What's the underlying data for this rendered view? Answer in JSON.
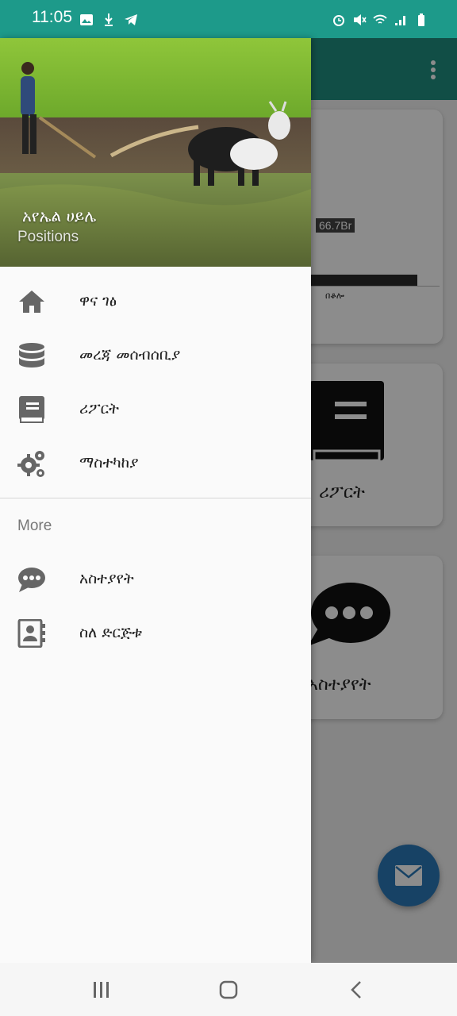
{
  "status_bar": {
    "time": "11:05",
    "left_icons": [
      "gallery-icon",
      "usb-icon",
      "telegram-icon"
    ],
    "right_icons": [
      "alarm-icon",
      "mute-icon",
      "wifi-icon",
      "signal-icon",
      "battery-icon"
    ]
  },
  "app": {
    "chart": {
      "value_label": "66.7Br",
      "category_label": "በቆሎ"
    },
    "cards": [
      {
        "label": "ሪፖርት",
        "icon": "book-icon"
      },
      {
        "label": "አስተያየት",
        "icon": "chat-icon"
      }
    ],
    "fab_icon": "mail-icon"
  },
  "drawer": {
    "user_name": "አየኤል ሀይሌ",
    "user_subtitle": "Positions",
    "menu_items": [
      {
        "label": "ዋና ገፅ",
        "icon": "home-icon"
      },
      {
        "label": "መረጃ መሰብሰቢያ",
        "icon": "database-icon"
      },
      {
        "label": "ሪፖርት",
        "icon": "book-icon"
      },
      {
        "label": "ማስተካከያ",
        "icon": "gears-icon"
      }
    ],
    "section_title": "More",
    "more_items": [
      {
        "label": "አስተያየት",
        "icon": "chat-icon"
      },
      {
        "label": "ስለ ድርጅቱ",
        "icon": "contact-book-icon"
      }
    ]
  },
  "colors": {
    "status_bar": "#1d9a8a",
    "toolbar": "#1f8f80",
    "fab": "#2a78b8",
    "drawer_bg": "#fafafa"
  }
}
